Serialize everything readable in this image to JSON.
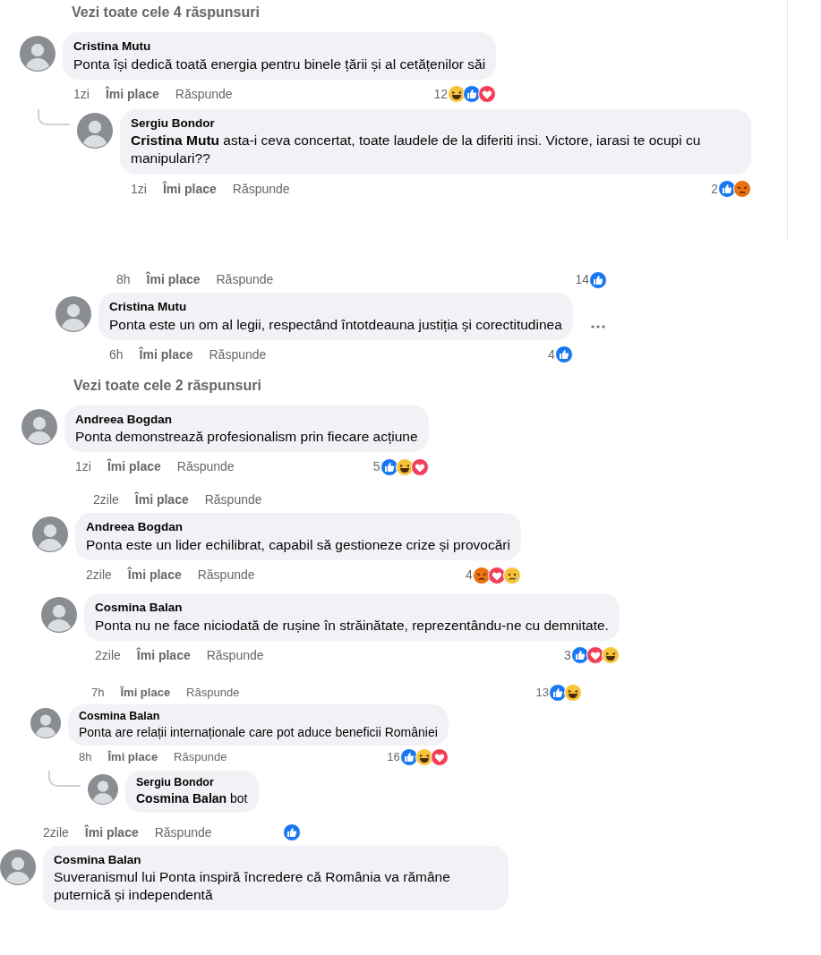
{
  "panels": [
    {
      "items": [
        {
          "kind": "see_more",
          "label": "Vezi toate cele 4 răspunsuri"
        },
        {
          "kind": "comment",
          "reply": false,
          "author": "Cristina Mutu",
          "text": "Ponta își dedică toată energia pentru binele țării și al cetățenilor săi",
          "meta": {
            "time": "1zi",
            "like": "Îmi place",
            "answer": "Răspunde",
            "count": "12",
            "reactions": [
              {
                "kind": "haha"
              },
              {
                "kind": "like"
              },
              {
                "kind": "love"
              }
            ]
          }
        },
        {
          "kind": "comment",
          "reply": true,
          "author": "Sergiu Bondor",
          "text": "**Cristina Mutu** asta-i ceva concertat, toate laudele de la diferiti insi. Victore, iarasi te ocupi cu manipulari??",
          "meta": {
            "time": "1zi",
            "like": "Îmi place",
            "answer": "Răspunde",
            "count": "2",
            "reactions": [
              {
                "kind": "like"
              },
              {
                "kind": "angry"
              }
            ]
          }
        }
      ]
    },
    {
      "items": [
        {
          "kind": "meta",
          "time": "8h",
          "like": "Îmi place",
          "answer": "Răspunde",
          "count": "14",
          "reactions": [
            {
              "kind": "like"
            }
          ]
        },
        {
          "kind": "comment",
          "reply": false,
          "more": true,
          "author": "Cristina Mutu",
          "text": "Ponta este un om al legii, respectând întotdeauna justiția și corectitudinea",
          "meta": {
            "time": "6h",
            "like": "Îmi place",
            "answer": "Răspunde",
            "count": "4",
            "reactions": [
              {
                "kind": "like"
              }
            ]
          }
        }
      ]
    },
    {
      "items": [
        {
          "kind": "see_more",
          "label": "Vezi toate cele 2 răspunsuri"
        },
        {
          "kind": "comment",
          "reply": false,
          "author": "Andreea Bogdan",
          "text": "Ponta demonstrează profesionalism prin fiecare acțiune",
          "meta": {
            "time": "1zi",
            "like": "Îmi place",
            "answer": "Răspunde",
            "count": "5",
            "reactions": [
              {
                "kind": "like"
              },
              {
                "kind": "haha"
              },
              {
                "kind": "love"
              }
            ]
          }
        }
      ]
    },
    {
      "items": [
        {
          "kind": "meta",
          "time": "2zile",
          "like": "Îmi place",
          "answer": "Răspunde"
        },
        {
          "kind": "comment",
          "reply": false,
          "author": "Andreea Bogdan",
          "text": "Ponta este un lider echilibrat, capabil să gestioneze crize și provocări",
          "meta": {
            "time": "2zile",
            "like": "Îmi place",
            "answer": "Răspunde",
            "count": "4",
            "reactions": [
              {
                "kind": "angry"
              },
              {
                "kind": "love"
              },
              {
                "kind": "sad"
              }
            ]
          }
        }
      ]
    },
    {
      "items": [
        {
          "kind": "comment",
          "reply": false,
          "author": "Cosmina Balan",
          "text": "Ponta nu ne face niciodată de rușine în străinătate, reprezentându-ne cu demnitate.",
          "meta": {
            "time": "2zile",
            "like": "Îmi place",
            "answer": "Răspunde",
            "count": "3",
            "reactions": [
              {
                "kind": "like"
              },
              {
                "kind": "love"
              },
              {
                "kind": "haha"
              }
            ]
          }
        }
      ]
    },
    {
      "items": [
        {
          "kind": "meta",
          "time": "7h",
          "like": "Îmi place",
          "answer": "Răspunde",
          "count": "13",
          "reactions": [
            {
              "kind": "like"
            },
            {
              "kind": "haha"
            }
          ]
        },
        {
          "kind": "comment",
          "reply": false,
          "author": "Cosmina Balan",
          "text": "Ponta are relații internaționale care pot aduce beneficii României",
          "meta": {
            "time": "8h",
            "like": "Îmi place",
            "answer": "Răspunde",
            "count": "16",
            "reactions": [
              {
                "kind": "like"
              },
              {
                "kind": "haha"
              },
              {
                "kind": "love"
              }
            ]
          }
        },
        {
          "kind": "comment",
          "reply": true,
          "author": "Sergiu Bondor",
          "text": "**Cosmina Balan** bot"
        }
      ]
    },
    {
      "items": [
        {
          "kind": "meta",
          "time": "2zile",
          "like": "Îmi place",
          "answer": "Răspunde",
          "reactions": [
            {
              "kind": "like"
            }
          ]
        },
        {
          "kind": "comment",
          "reply": false,
          "author": "Cosmina Balan",
          "text": "Suveranismul lui Ponta inspiră încredere că România va rămâne puternică și independentă"
        }
      ]
    }
  ]
}
